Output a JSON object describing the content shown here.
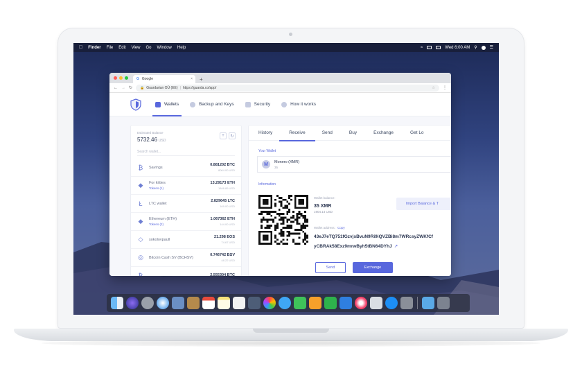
{
  "menubar": {
    "app_name": "Finder",
    "menus": [
      "File",
      "Edit",
      "View",
      "Go",
      "Window",
      "Help"
    ],
    "clock": "Wed 6:00 AM"
  },
  "browser": {
    "tab_title": "Google",
    "site_name": "Guardarian OÜ (EE)",
    "url": "https://guarda.co/app/"
  },
  "app_nav": [
    {
      "label": "Wallets"
    },
    {
      "label": "Backup and Keys"
    },
    {
      "label": "Security"
    },
    {
      "label": "How it works"
    }
  ],
  "sidebar": {
    "estimated_label": "Estimated Balance",
    "estimated_value": "5732.46",
    "estimated_currency": "USD",
    "search_placeholder": "Search wallet...",
    "wallets": [
      {
        "icon": "bitcoin-icon",
        "name": "Savings",
        "sub": "",
        "amount": "0.881202 BTC",
        "usd": "8064.00 USD"
      },
      {
        "icon": "ethereum-icon",
        "name": "For kitties",
        "sub": "Tokens (1)",
        "amount": "13.29173 ETH",
        "usd": "1846.89 USD"
      },
      {
        "icon": "litecoin-icon",
        "name": "LTC wallet",
        "sub": "",
        "amount": "2.829645 LTC",
        "usd": "169.00 USD"
      },
      {
        "icon": "ethereum-icon",
        "name": "Ethereum (ETH)",
        "sub": "Tokens (2)",
        "amount": "1.067362 ETH",
        "usd": "144.00 USD"
      },
      {
        "icon": "eos-icon",
        "name": "sokolovpaull",
        "sub": "",
        "amount": "21.298 EOS",
        "usd": "74.67 USD"
      },
      {
        "icon": "bitcoin-sv-icon",
        "name": "Bitcoin Cash SV (BCHSV)",
        "sub": "",
        "amount": "0.746742 BSV",
        "usd": "48.22 USD"
      },
      {
        "icon": "bitcoin-icon",
        "name": "",
        "sub": "",
        "amount": "2.555304 BTC",
        "usd": ""
      }
    ]
  },
  "tabs": [
    "History",
    "Receive",
    "Send",
    "Buy",
    "Exchange",
    "Get Lo"
  ],
  "receive": {
    "your_wallet_label": "Your Wallet",
    "wallet_name": "Monero (XMR)",
    "wallet_sub": "35",
    "information_label": "Information",
    "balance_label": "Wallet balance:",
    "balance_value": "35 XMR",
    "balance_usd": "1904.14 USD",
    "address_label": "Wallet address:",
    "copy_label": "Copy",
    "address_line1": "43eJ7eTQ751fGzvjsBvuN9Ri9iQVZBi8m7WRcsyZWKfCf",
    "address_line2": "yCBRAk58Exz9mrwByh5tBN64DYhJ",
    "import_label": "Import Balance & T",
    "send_label": "Send",
    "exchange_label": "Exchange"
  },
  "colors": {
    "accent": "#5867dd",
    "text_dark": "#2a3550"
  }
}
